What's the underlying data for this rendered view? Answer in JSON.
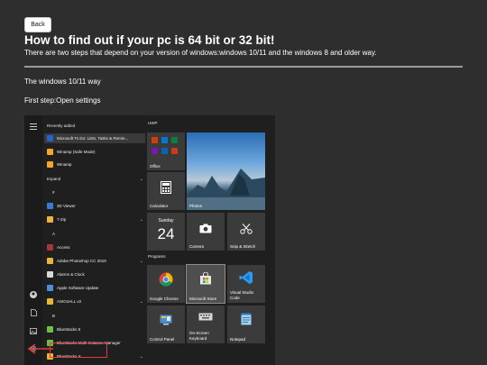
{
  "header": {
    "back_label": "Back",
    "title": "How to find out if your pc is 64 bit or 32 bit!",
    "subtitle": "There are two steps that depend on your version of windows:windows 10/11 and the windows 8 and older way."
  },
  "section": {
    "title": "The windows 10/11 way",
    "step": "First step:Open settings"
  },
  "startmenu": {
    "app_list": [
      {
        "label": "Recently added",
        "kind": "header",
        "icon": "",
        "color": ""
      },
      {
        "label": "Microsoft To Do: Lists, Tasks & Remin...",
        "kind": "app",
        "icon": "check-icon",
        "color": "#2564cf",
        "highlight": true
      },
      {
        "label": "Winamp (Safe Mode)",
        "kind": "app",
        "icon": "winamp-icon",
        "color": "#f5a623"
      },
      {
        "label": "Winamp",
        "kind": "app",
        "icon": "winamp-icon",
        "color": "#f5a623"
      },
      {
        "label": "Expand",
        "kind": "header",
        "icon": "",
        "color": "",
        "chevron": true
      },
      {
        "label": "#",
        "kind": "letter",
        "icon": "",
        "color": ""
      },
      {
        "label": "3D Viewer",
        "kind": "app",
        "icon": "cube-icon",
        "color": "#3a7bd5"
      },
      {
        "label": "7-Zip",
        "kind": "app",
        "icon": "folder-icon",
        "color": "#e8b73a",
        "chevron": true
      },
      {
        "label": "A",
        "kind": "letter",
        "icon": "",
        "color": ""
      },
      {
        "label": "Access",
        "kind": "app",
        "icon": "access-icon",
        "color": "#a4373a"
      },
      {
        "label": "Adobe Photoshop CC 2019",
        "kind": "app",
        "icon": "folder-icon",
        "color": "#e8b73a",
        "chevron": true
      },
      {
        "label": "Alarms & Clock",
        "kind": "app",
        "icon": "clock-icon",
        "color": "#d8d8d8"
      },
      {
        "label": "Apple Software Update",
        "kind": "app",
        "icon": "apple-icon",
        "color": "#4a90d9"
      },
      {
        "label": "ASIO4ALL v2",
        "kind": "app",
        "icon": "folder-icon",
        "color": "#e8b73a",
        "chevron": true
      },
      {
        "label": "B",
        "kind": "letter",
        "icon": "",
        "color": ""
      },
      {
        "label": "BlueStacks 5",
        "kind": "app",
        "icon": "bluestacks-icon",
        "color": "#6cc04a"
      },
      {
        "label": "BlueStacks Multi-Instance Manager",
        "kind": "app",
        "icon": "bluestacks-icon",
        "color": "#6cc04a"
      },
      {
        "label": "BlueStacks X",
        "kind": "app",
        "icon": "folder-icon",
        "color": "#e8b73a",
        "chevron": true
      }
    ],
    "groups": {
      "uwp": "UWP",
      "programs": "Programs"
    },
    "tiles": {
      "office": "Office",
      "calculator": "Calculator",
      "photos": "Photos",
      "calendar_day": "Sunday",
      "calendar_date": "24",
      "camera": "Camera",
      "snip": "Snip & Sketch",
      "chrome": "Google Chrome",
      "msstore": "Microsoft Store",
      "vscode": "Visual Studio Code",
      "osk": "On-Screen Keyboard",
      "control_panel": "Control Panel",
      "notepad": "Notepad"
    },
    "colors": {
      "annotation": "#e53935",
      "tile_bg": "#3b3b3b",
      "menu_bg": "#1f1f1f"
    }
  }
}
